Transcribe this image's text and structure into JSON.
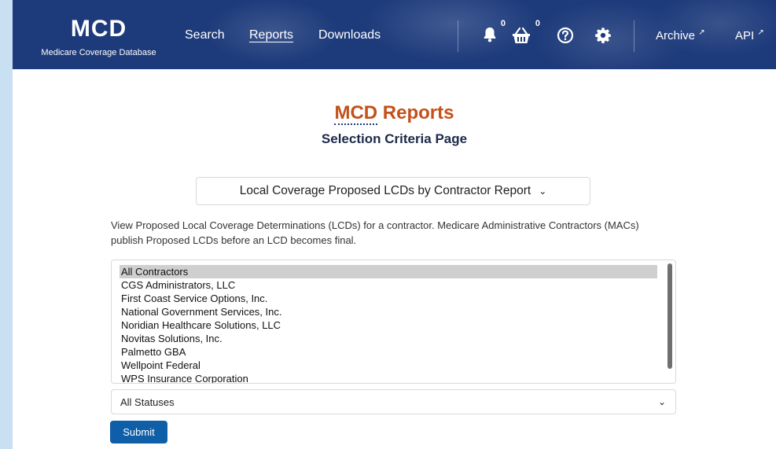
{
  "header": {
    "logo": "MCD",
    "logo_subtitle": "Medicare Coverage Database",
    "nav": [
      {
        "label": "Search"
      },
      {
        "label": "Reports"
      },
      {
        "label": "Downloads"
      }
    ],
    "notifications_count": "0",
    "basket_count": "0",
    "archive_label": "Archive",
    "api_label": "API"
  },
  "main": {
    "title_abbr": "MCD",
    "title_rest": " Reports",
    "subtitle": "Selection Criteria Page",
    "report_type": "Local Coverage Proposed LCDs by Contractor Report",
    "description": "View Proposed Local Coverage Determinations (LCDs) for a contractor. Medicare Administrative Contractors (MACs) publish Proposed LCDs before an LCD becomes final.",
    "contractors": [
      "All Contractors",
      "CGS Administrators, LLC",
      "First Coast Service Options, Inc.",
      "National Government Services, Inc.",
      "Noridian Healthcare Solutions, LLC",
      "Novitas Solutions, Inc.",
      "Palmetto GBA",
      "Wellpoint Federal",
      "WPS Insurance Corporation"
    ],
    "selected_contractor": "All Contractors",
    "status": "All Statuses",
    "submit_label": "Submit"
  },
  "colors": {
    "header_bg": "#1d3a7a",
    "title": "#c4501a",
    "submit": "#0f5fa8"
  }
}
